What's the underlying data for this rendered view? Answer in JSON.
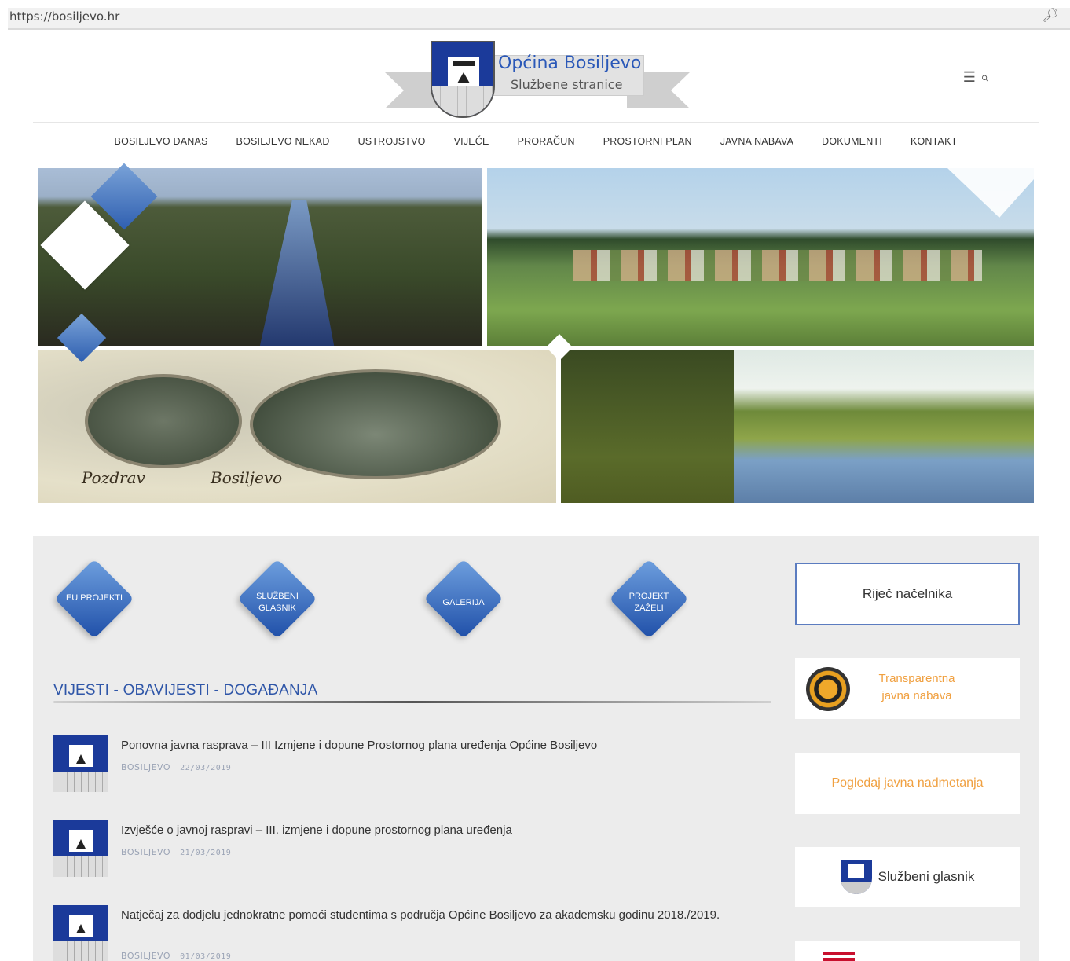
{
  "browser": {
    "url": "https://bosiljevo.hr",
    "zoom_icon": "zoom-icon"
  },
  "header": {
    "logo_title": "Općina Bosiljevo",
    "logo_subtitle": "Službene stranice",
    "menu_icon": "hamburger-icon",
    "search_icon": "search-icon"
  },
  "nav": {
    "items": [
      "BOSILJEVO DANAS",
      "BOSILJEVO NEKAD",
      "USTROJSTVO",
      "VIJEĆE",
      "PRORAČUN",
      "PROSTORNI PLAN",
      "JAVNA NABAVA",
      "DOKUMENTI",
      "KONTAKT"
    ]
  },
  "banner": {
    "caption_left": "Pozdrav",
    "caption_right": "Bosiljevo"
  },
  "quick_links": [
    {
      "l1": "EU PROJEKTI",
      "l2": ""
    },
    {
      "l1": "SLUŽBENI",
      "l2": "GLASNIK"
    },
    {
      "l1": "GALERIJA",
      "l2": ""
    },
    {
      "l1": "PROJEKT",
      "l2": "ZAŽELI"
    }
  ],
  "news": {
    "heading": "VIJESTI - OBAVIJESTI - DOGAĐANJA",
    "items": [
      {
        "title": "Ponovna javna rasprava – III Izmjene i dopune Prostornog plana uređenja Općine Bosiljevo",
        "category": "BOSILJEVO",
        "date": "22/03/2019"
      },
      {
        "title": "Izvješće o javnoj raspravi – III. izmjene i dopune prostornog plana uređenja",
        "category": "BOSILJEVO",
        "date": "21/03/2019"
      },
      {
        "title": "Natječaj za dodjelu jednokratne pomoći studentima s područja Općine Bosiljevo za akademsku godinu 2018./2019.",
        "category": "BOSILJEVO",
        "date": "01/03/2019"
      }
    ]
  },
  "sidebar": {
    "rijec": "Riječ načelnika",
    "transparent_l1": "Transparentna",
    "transparent_l2": "javna nabava",
    "nadmetanja": "Pogledaj javna nadmetanja",
    "glasnik": "Službeni glasnik"
  },
  "colors": {
    "accent": "#2f56a8",
    "orange": "#f0a040",
    "content_bg": "#ececec"
  }
}
